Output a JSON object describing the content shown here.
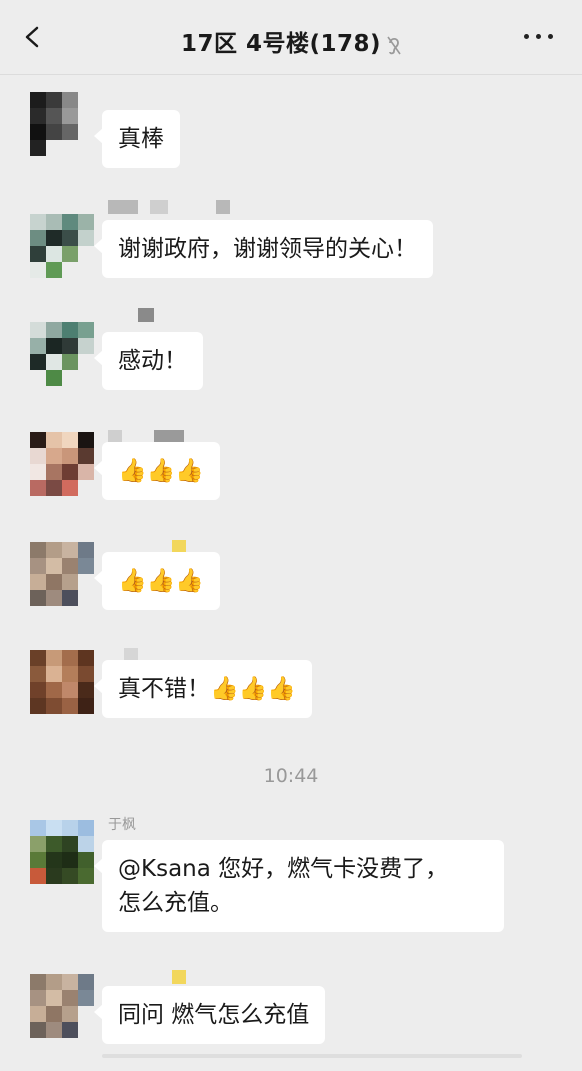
{
  "header": {
    "title": "17区 4号楼(178)",
    "back_icon": "chevron-left-icon",
    "mute_icon": "ear-muted-icon",
    "more_icon": "more-dots-icon"
  },
  "timestamp": "10:44",
  "messages": [
    {
      "text": "真棒"
    },
    {
      "text": "谢谢政府，谢谢领导的关心！"
    },
    {
      "text": "感动！"
    },
    {
      "text": "👍👍👍"
    },
    {
      "text": "👍👍👍"
    },
    {
      "text": "真不错！👍👍👍"
    },
    {
      "nickname": "于枫",
      "text": "@Ksana 您好，燃气卡没费了，\n怎么充值。"
    },
    {
      "text": "同问 燃气怎么充值"
    }
  ]
}
